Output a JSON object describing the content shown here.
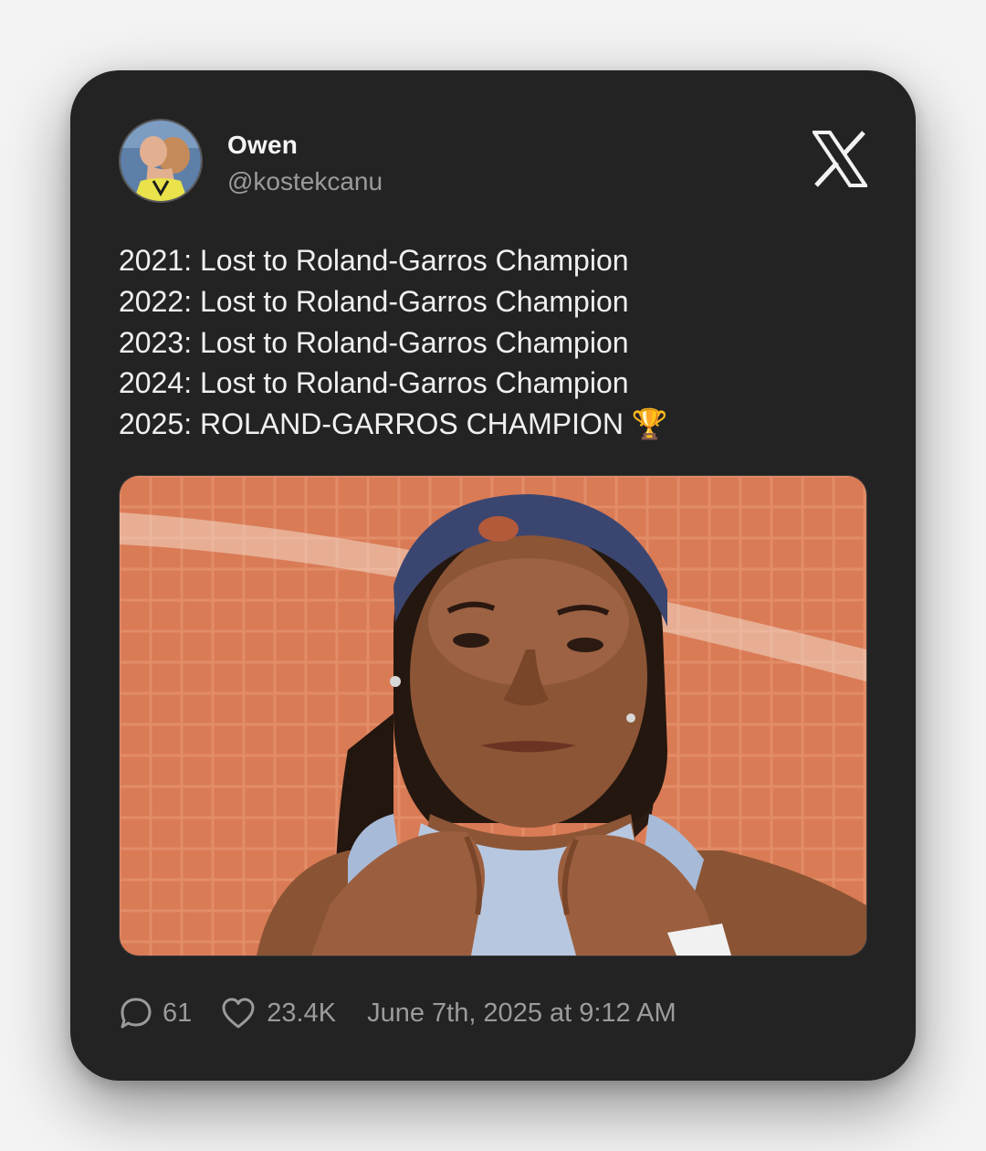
{
  "author": {
    "name": "Owen",
    "handle": "@kostekcanu"
  },
  "tweet": {
    "lines": [
      "2021: Lost to Roland-Garros Champion",
      "2022: Lost to Roland-Garros Champion",
      "2023: Lost to Roland-Garros Champion",
      "2024: Lost to Roland-Garros Champion",
      "2025: ROLAND-GARROS CHAMPION 🏆"
    ]
  },
  "stats": {
    "replies": "61",
    "likes": "23.4K",
    "timestamp": "June 7th, 2025 at 9:12 AM"
  },
  "icons": {
    "brand": "x-logo-icon",
    "reply": "speech-bubble-icon",
    "like": "heart-icon"
  },
  "colors": {
    "card_background": "#232323",
    "page_background": "#f3f3f3",
    "primary_text": "#f0f0f0",
    "secondary_text": "#9b9b9b"
  }
}
